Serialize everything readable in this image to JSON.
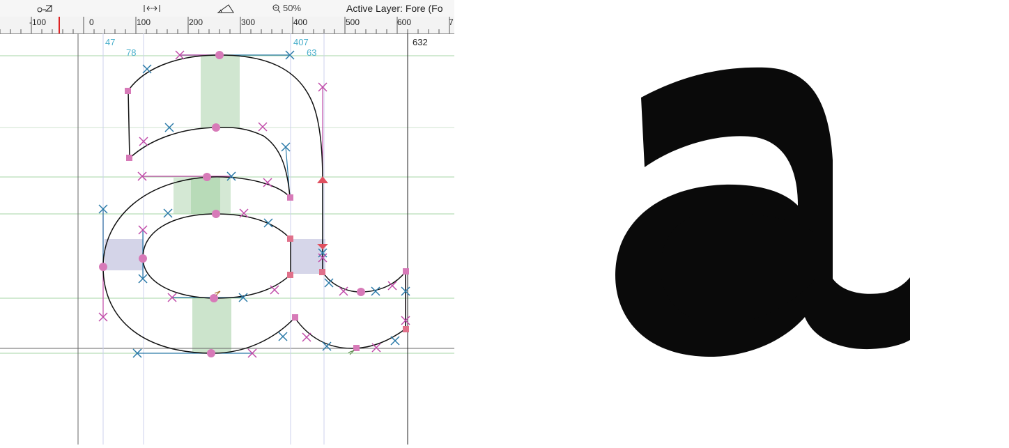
{
  "toolbar": {
    "measure_tool_icon": "scale-tool-icon",
    "width_tool_icon": "width-arrows-icon",
    "angle_tool_icon": "angle-tool-icon",
    "zoom_icon": "zoom-icon",
    "zoom_level": "50%",
    "active_layer": "Active Layer: Fore (Fo"
  },
  "ruler": {
    "labels": [
      "-100",
      "0",
      "100",
      "200",
      "300",
      "400",
      "500",
      "600",
      "7"
    ]
  },
  "metrics": {
    "left_outer": "47",
    "left_inner": "78",
    "right_inner": "407",
    "right_outer": "63",
    "advance_width": "632"
  },
  "colors": {
    "off_curve_magenta": "#c04aa8",
    "off_curve_blue": "#2a7aa8",
    "on_curve_point": "#d77ab8",
    "corner_point": "#e0708a",
    "stem_band_green": "#b7d8b7",
    "stem_band_purple": "#c5c5e0",
    "guide_green": "#a6d4a6",
    "metric_label": "#4ab0cc",
    "glyph_fill": "#0a0a0a"
  },
  "preview": {
    "glyph": "a"
  }
}
